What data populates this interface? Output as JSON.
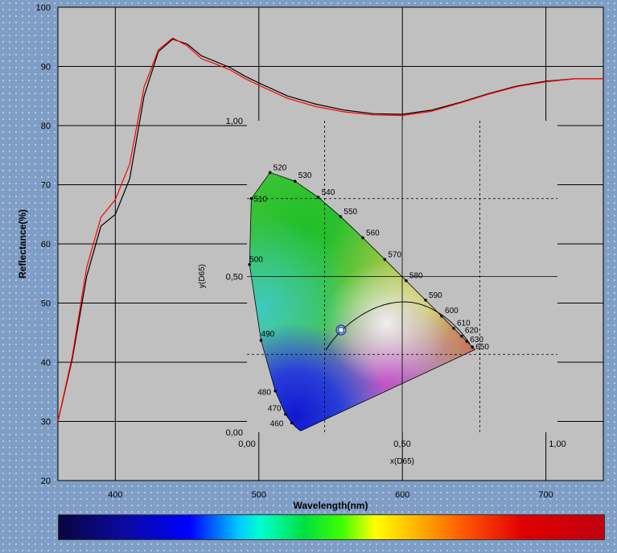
{
  "chart_data": [
    {
      "type": "line",
      "xlabel": "Wavelength(nm)",
      "ylabel": "Reflectance(%)",
      "xlim": [
        360,
        740
      ],
      "ylim": [
        20,
        100
      ],
      "x_ticks": [
        "400",
        "500",
        "600",
        "700"
      ],
      "y_ticks": [
        "20",
        "30",
        "40",
        "50",
        "60",
        "70",
        "80",
        "90",
        "100"
      ],
      "grid": true,
      "series": [
        {
          "color": "#000000",
          "x": [
            360,
            370,
            380,
            390,
            400,
            410,
            420,
            430,
            440,
            450,
            460,
            470,
            480,
            490,
            500,
            520,
            540,
            560,
            580,
            600,
            620,
            640,
            660,
            680,
            700,
            720,
            740
          ],
          "y": [
            30.0,
            40.5,
            54.5,
            63.0,
            65.0,
            71.0,
            85.0,
            92.5,
            94.6,
            93.8,
            91.8,
            90.8,
            89.8,
            88.4,
            87.2,
            85.0,
            83.6,
            82.6,
            82.0,
            81.9,
            82.6,
            83.9,
            85.4,
            86.7,
            87.5,
            87.9,
            87.9
          ]
        },
        {
          "color": "#ff0000",
          "x": [
            360,
            370,
            380,
            390,
            400,
            410,
            420,
            430,
            440,
            450,
            460,
            470,
            480,
            490,
            500,
            520,
            540,
            560,
            580,
            600,
            620,
            640,
            660,
            680,
            700,
            720,
            740
          ],
          "y": [
            30.0,
            41.0,
            56.0,
            64.5,
            67.5,
            73.5,
            86.5,
            92.8,
            94.8,
            93.5,
            91.3,
            90.4,
            89.4,
            88.0,
            86.8,
            84.6,
            83.2,
            82.3,
            81.8,
            81.7,
            82.4,
            83.8,
            85.3,
            86.6,
            87.4,
            87.9,
            87.9
          ]
        }
      ]
    },
    {
      "type": "scatter",
      "xlabel": "x(D65)",
      "ylabel": "y(D65)",
      "xlim": [
        0,
        1
      ],
      "ylim": [
        0,
        1
      ],
      "x_ticks": [
        "0,00",
        "0,50",
        "1,00"
      ],
      "y_ticks": [
        "0,00",
        "0,50",
        "1,00"
      ],
      "locus_labels": [
        "460",
        "470",
        "480",
        "490",
        "500",
        "510",
        "520",
        "530",
        "540",
        "550",
        "560",
        "570",
        "580",
        "590",
        "600",
        "610",
        "620",
        "630",
        "650"
      ],
      "current_point": {
        "x": 0.31,
        "y": 0.33
      }
    }
  ],
  "spectrum_bar": {
    "range_nm": [
      360,
      740
    ]
  }
}
